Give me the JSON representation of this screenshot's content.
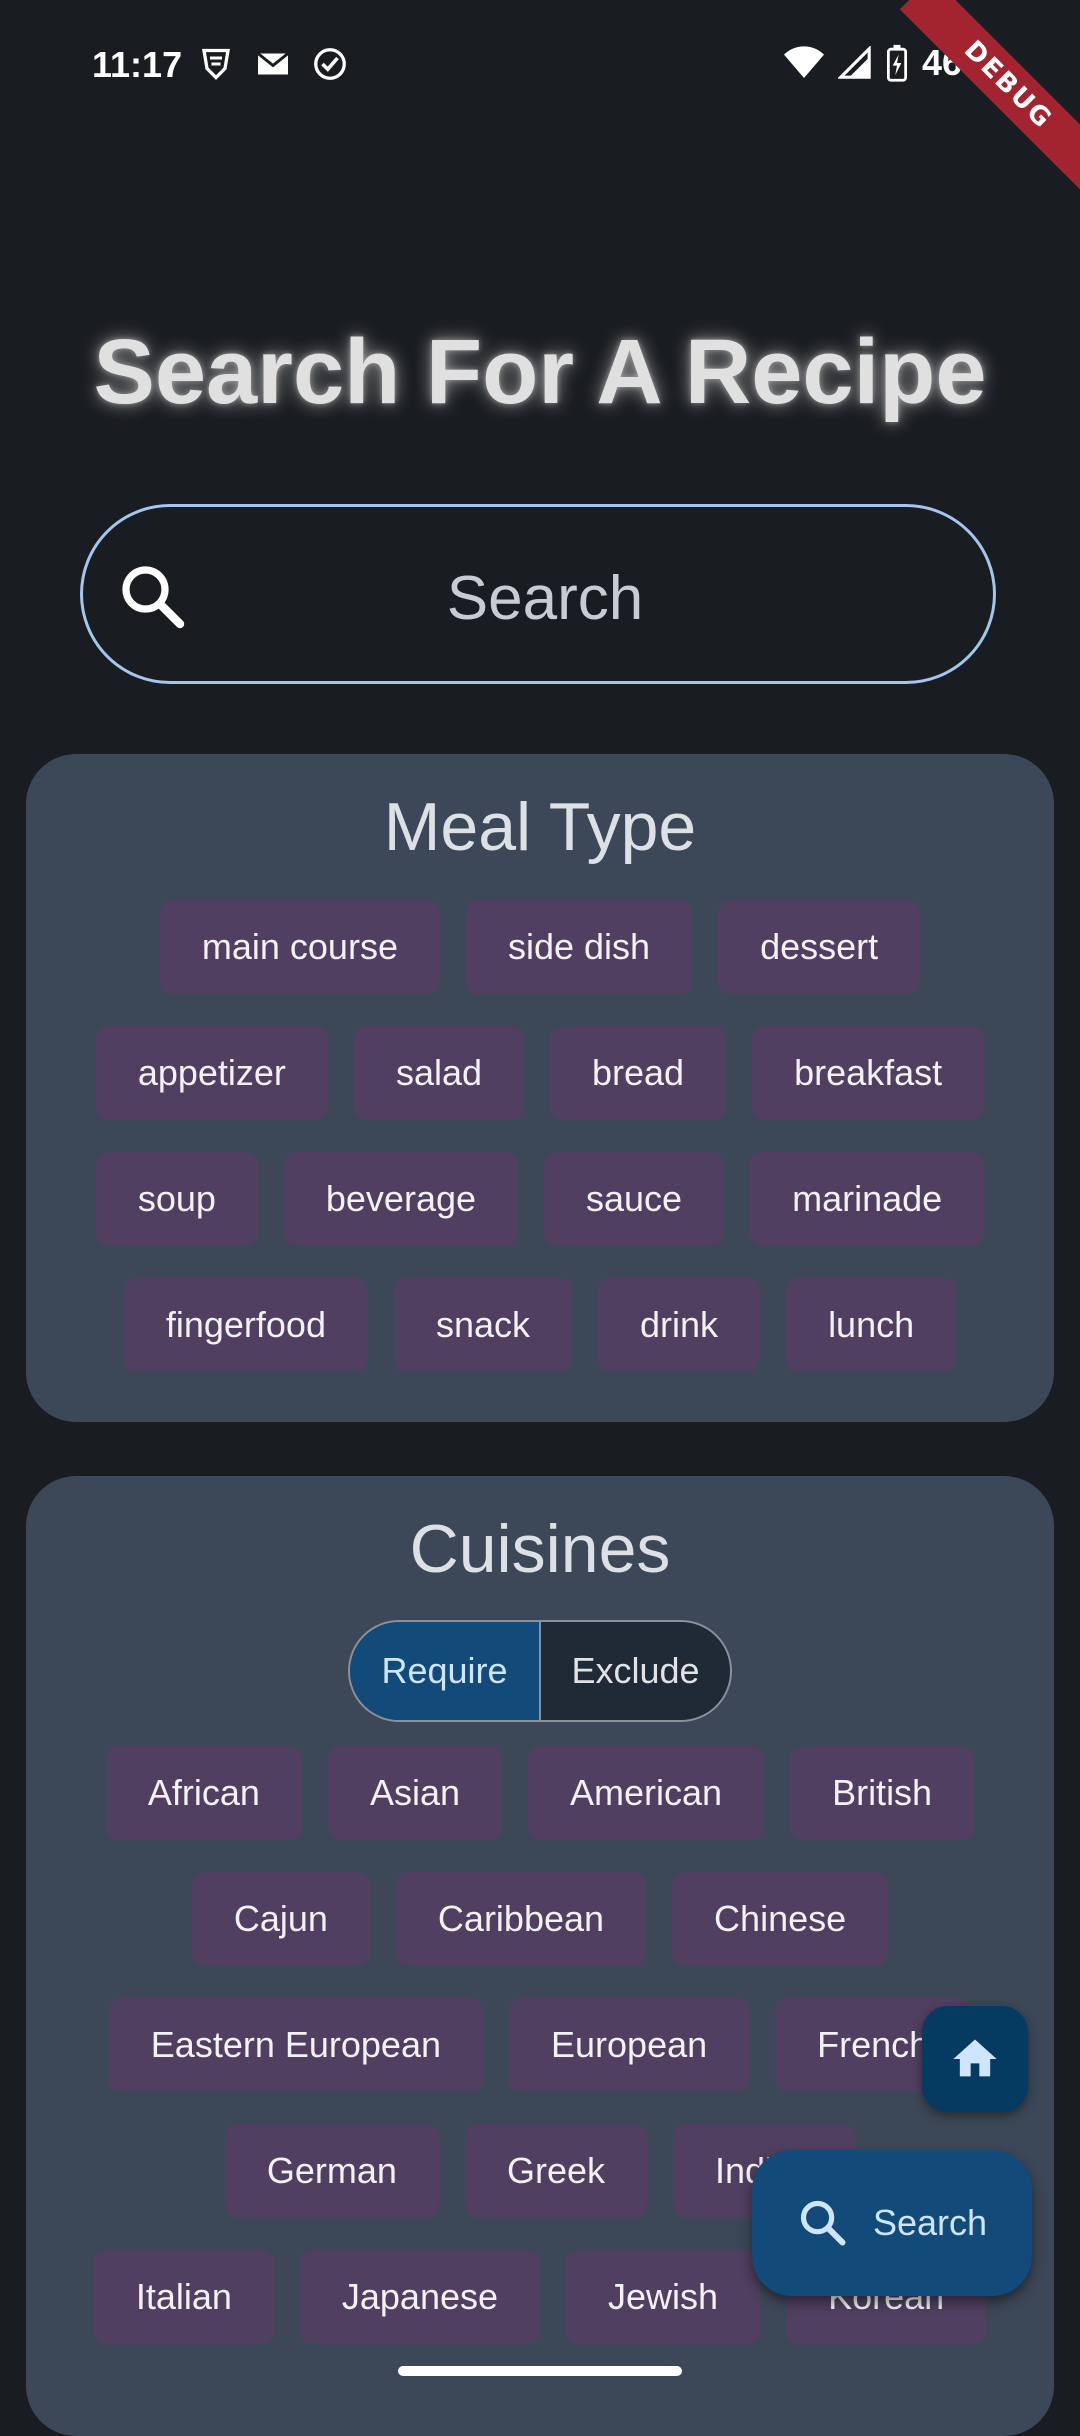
{
  "status": {
    "time": "11:17",
    "battery_percent": "46%"
  },
  "debug_banner": "DEBUG",
  "page_title": "Search For A Recipe",
  "search": {
    "placeholder": "Search"
  },
  "meal_type": {
    "title": "Meal Type",
    "rows": [
      [
        "main course",
        "side dish",
        "dessert"
      ],
      [
        "appetizer",
        "salad",
        "bread",
        "breakfast"
      ],
      [
        "soup",
        "beverage",
        "sauce",
        "marinade"
      ],
      [
        "fingerfood",
        "snack",
        "drink",
        "lunch"
      ]
    ]
  },
  "cuisines": {
    "title": "Cuisines",
    "toggle": {
      "require": "Require",
      "exclude": "Exclude",
      "selected": "Require"
    },
    "rows": [
      [
        "African",
        "Asian",
        "American",
        "British"
      ],
      [
        "Cajun",
        "Caribbean",
        "Chinese"
      ],
      [
        "Eastern European",
        "European",
        "French"
      ],
      [
        "German",
        "Greek",
        "Indian"
      ],
      [
        "Italian",
        "Japanese",
        "Jewish",
        "Korean"
      ]
    ]
  },
  "fab": {
    "search_label": "Search",
    "home_icon": "home-icon"
  },
  "colors": {
    "background": "#191c20",
    "card": "#3c4757",
    "chip": "#503f60",
    "accent": "#124a79",
    "outline": "#a4c6ee"
  }
}
